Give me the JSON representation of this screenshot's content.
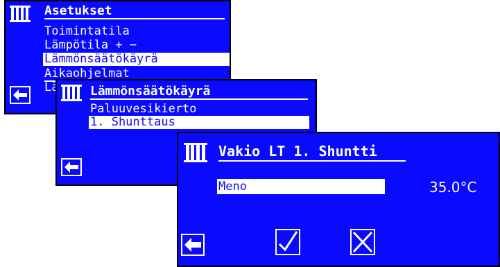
{
  "screen1": {
    "title": "Asetukset",
    "items": [
      "Toimintatila",
      "Lämpötila + −",
      "Lämmönsäätökäyrä",
      "Aikaohjelmat",
      "Lä"
    ],
    "selected_index": 2,
    "icons": [
      "radiator-icon",
      "back-arrow-icon"
    ]
  },
  "screen2": {
    "title": "Lämmönsäätökäyrä",
    "items": [
      "Paluuvesikierto",
      "1. Shunttaus"
    ],
    "selected_index": 1,
    "icons": [
      "radiator-icon",
      "back-arrow-icon"
    ]
  },
  "screen3": {
    "title": "Vakio LT 1. Shuntti",
    "field_label": "Meno",
    "field_value": "35.0°C",
    "icons": [
      "radiator-icon",
      "back-arrow-icon",
      "confirm-check-icon",
      "cancel-x-icon"
    ]
  },
  "colors": {
    "screen_bg": "#0a0aff",
    "text": "#ffffff",
    "border": "#000000"
  }
}
